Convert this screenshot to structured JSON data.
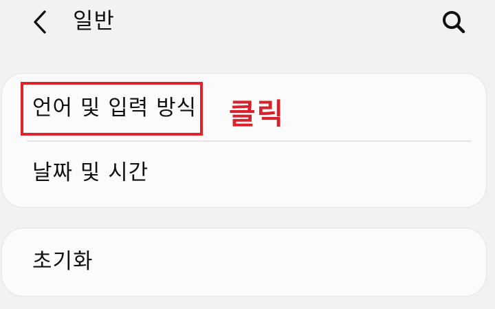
{
  "header": {
    "title": "일반",
    "back_icon": "chevron-left-icon",
    "search_icon": "search-icon"
  },
  "settings": {
    "group1": [
      {
        "label": "언어 및 입력 방식"
      },
      {
        "label": "날짜 및 시간"
      }
    ],
    "group2": [
      {
        "label": "초기화"
      }
    ]
  },
  "annotation": {
    "text": "클릭",
    "color": "#d8212a"
  }
}
